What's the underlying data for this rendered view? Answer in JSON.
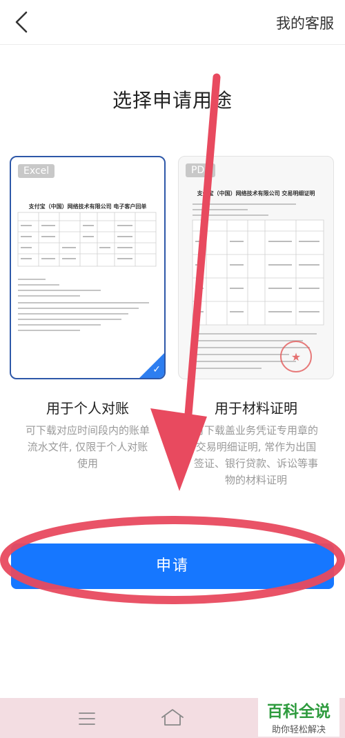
{
  "header": {
    "back_icon": "chevron-left-icon",
    "service_label": "我的客服"
  },
  "page": {
    "title": "选择申请用途"
  },
  "options": [
    {
      "badge": "Excel",
      "preview_title": "支付宝（中国）网络技术有限公司 电子客户回单",
      "title": "用于个人对账",
      "description_lines": [
        "可下载对应时间段内的账单",
        "流水文件, 仅限于个人对账",
        "使用"
      ],
      "selected": true
    },
    {
      "badge": "PDF",
      "preview_title": "支付宝（中国）网络技术有限公司 交易明细证明",
      "title": "用于材料证明",
      "description_lines": [
        "可下载盖业务凭证专用章的",
        "交易明细证明, 常作为出国",
        "签证、银行贷款、诉讼等事",
        "物的材料证明"
      ],
      "selected": false
    }
  ],
  "action": {
    "apply_label": "申请"
  },
  "navbar": {
    "icons": [
      "menu-icon",
      "home-icon"
    ]
  },
  "watermark": {
    "top": "百科全说",
    "bottom": "助你轻松解决"
  },
  "colors": {
    "accent": "#1677ff",
    "annotation": "#e84a5f",
    "selected_border": "#2d57a8",
    "navbar": "#f3dde2"
  }
}
